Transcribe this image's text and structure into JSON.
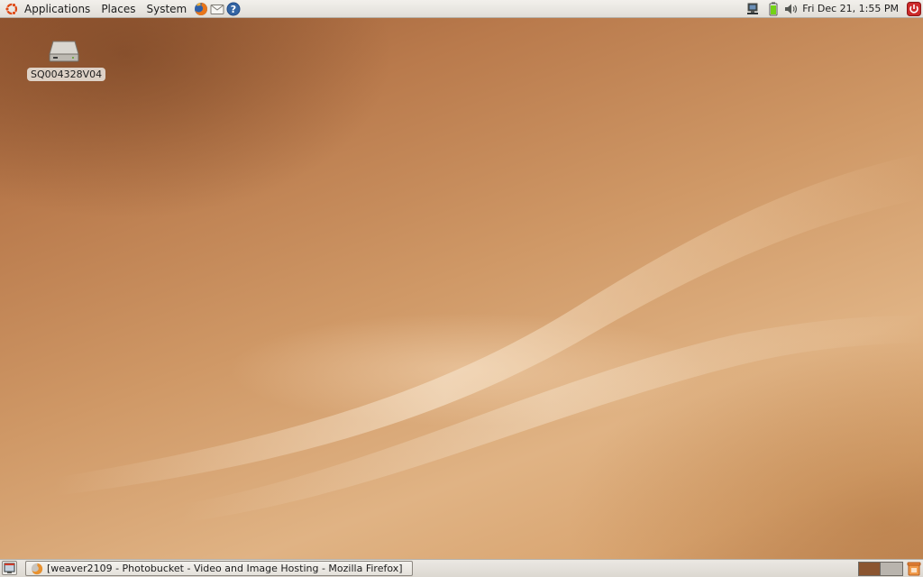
{
  "top_panel": {
    "menus": [
      "Applications",
      "Places",
      "System"
    ],
    "launchers": [
      "firefox-icon",
      "mail-icon",
      "help-icon"
    ],
    "tray": [
      "network-icon",
      "battery-icon",
      "volume-icon"
    ],
    "clock": "Fri Dec 21,  1:55 PM",
    "power_icon": "power-icon"
  },
  "desktop": {
    "icons": [
      {
        "label": "SQ004328V04",
        "icon": "drive-icon"
      }
    ]
  },
  "bottom_panel": {
    "taskbar": {
      "title": "[weaver2109 - Photobucket - Video and Image Hosting - Mozilla Firefox]",
      "icon": "firefox-icon"
    },
    "workspaces": [
      {
        "color": "#8b5530",
        "active": true
      },
      {
        "color": "#b9b4ad",
        "active": false
      }
    ],
    "trash_icon": "trash-icon"
  },
  "colors": {
    "panel": "#e8e6e1",
    "wallpaper": "#c88a58",
    "accent": "#dd4814"
  }
}
